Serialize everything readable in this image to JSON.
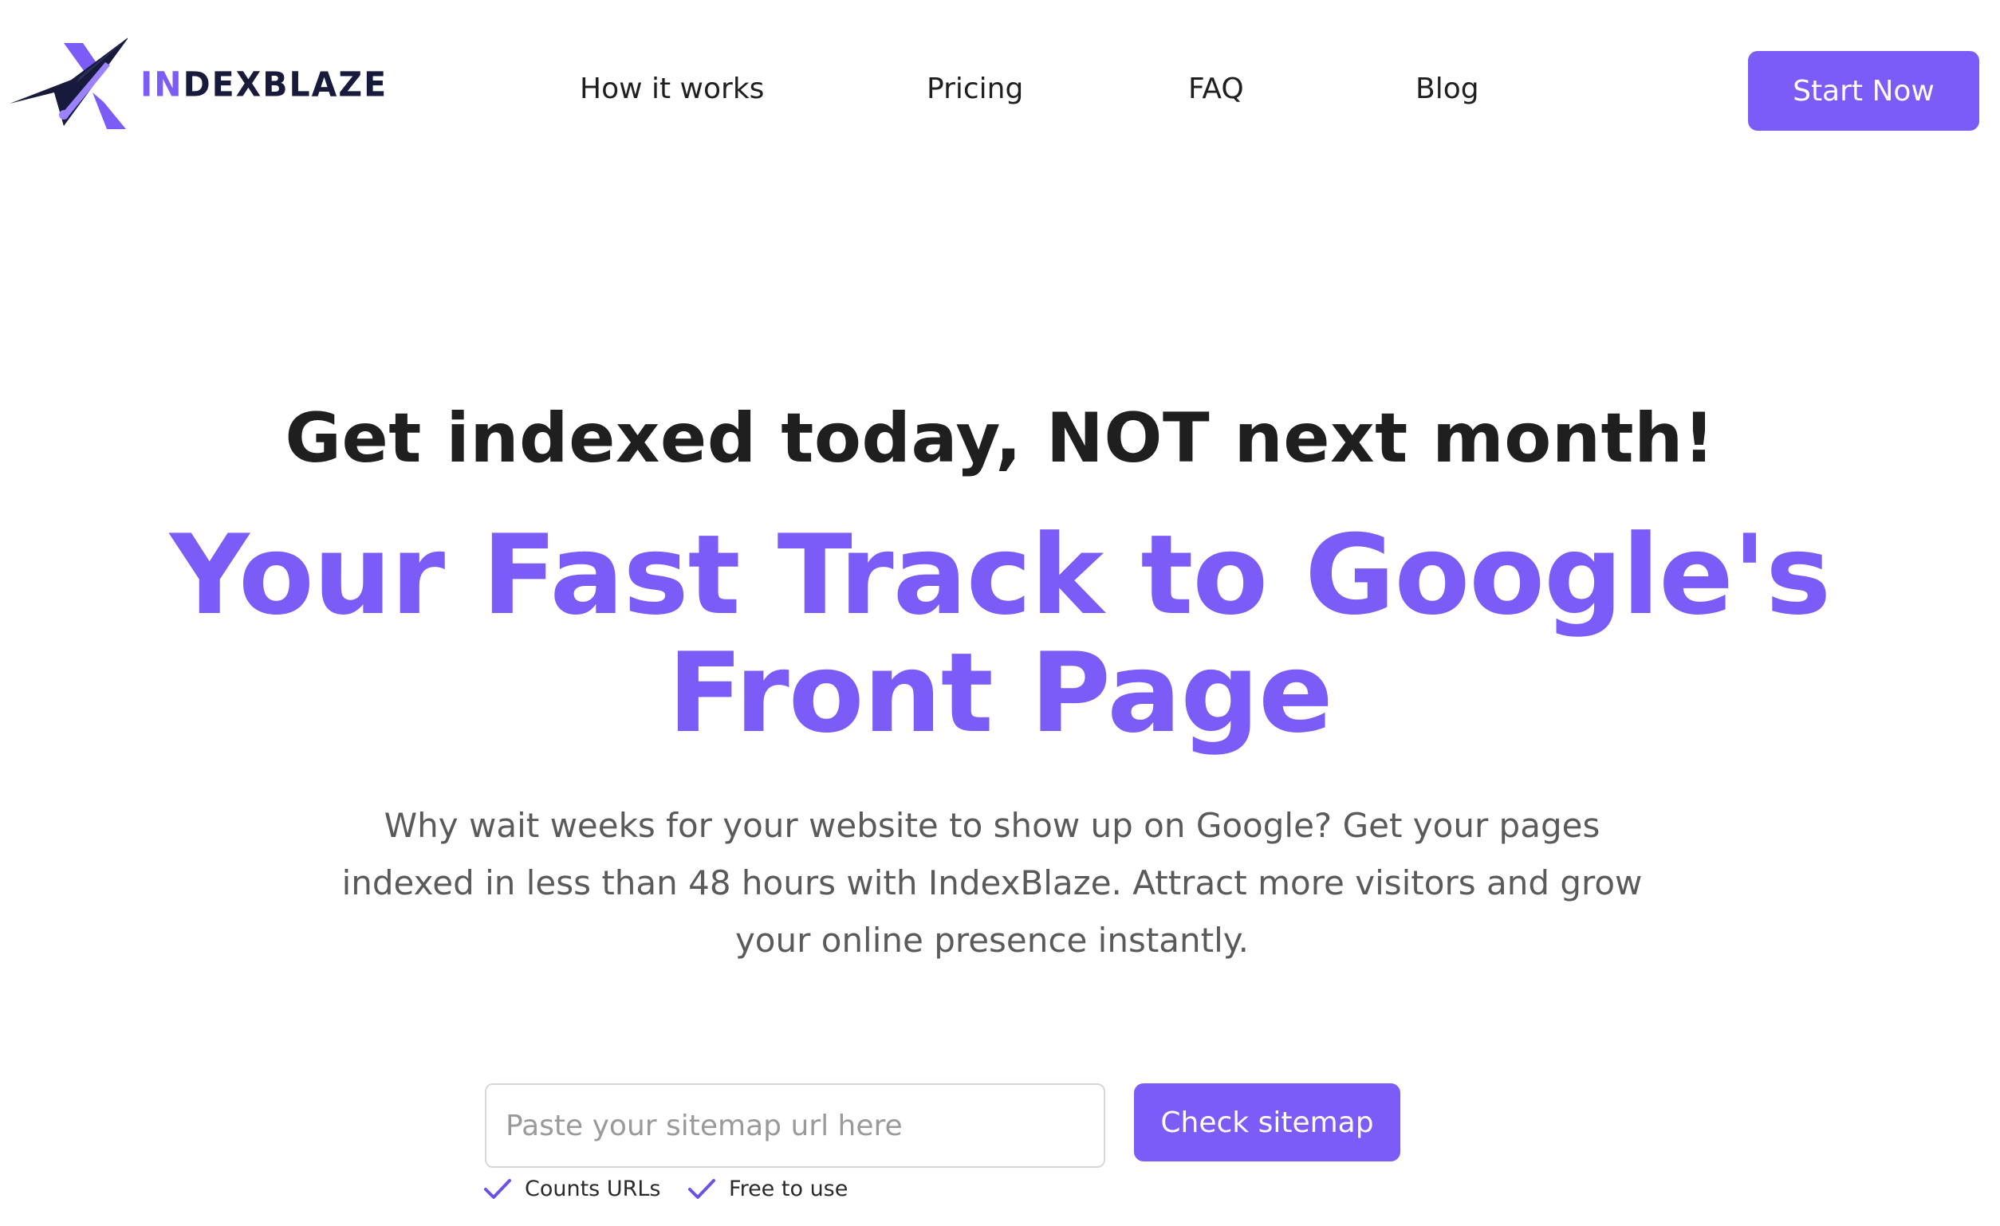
{
  "brand": {
    "name_part_a": "IN",
    "name_part_b": "DEXBLAZE",
    "accent_color": "#7c5cf6",
    "dark_color": "#171a3b"
  },
  "nav": {
    "items": [
      {
        "label": "How it works"
      },
      {
        "label": "Pricing"
      },
      {
        "label": "FAQ"
      },
      {
        "label": "Blog"
      }
    ],
    "cta_label": "Start Now"
  },
  "hero": {
    "eyebrow": "Get indexed today, NOT next month!",
    "title": "Your Fast Track to Google's Front Page",
    "description": "Why wait weeks for your website to show up on Google? Get your pages indexed in less than 48 hours with IndexBlaze. Attract more visitors and grow your online presence instantly."
  },
  "sitemap_form": {
    "input_value": "",
    "input_placeholder": "Paste your sitemap url here",
    "submit_label": "Check sitemap",
    "features": [
      {
        "icon": "check-icon",
        "label": "Counts URLs"
      },
      {
        "icon": "check-icon",
        "label": "Free to use"
      }
    ]
  }
}
